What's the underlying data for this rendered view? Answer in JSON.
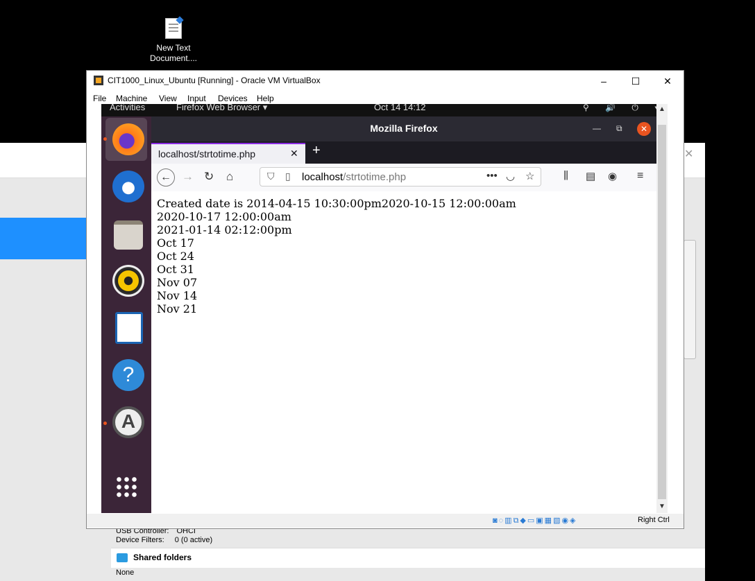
{
  "desktop": {
    "icon_label": "New Text Document...."
  },
  "vbox": {
    "title": "CIT1000_Linux_Ubuntu [Running] - Oracle VM VirtualBox",
    "minimize": "–",
    "maximize": "☐",
    "close": "✕",
    "menu": [
      "File",
      "Machine",
      "View",
      "Input",
      "Devices",
      "Help"
    ],
    "host_key": "Right Ctrl"
  },
  "gnome": {
    "activities": "Activities",
    "app_menu": "Firefox Web Browser ▾",
    "clock": "Oct 14  14:12",
    "tray": "⚲ 🔊 ⏻ ▾"
  },
  "firefox": {
    "window_title": "Mozilla Firefox",
    "tab_title": "localhost/strtotime.php",
    "new_tab": "+",
    "url_host": "localhost",
    "url_path": "/strtotime.php",
    "page_lines": [
      "Created date is 2014-04-15 10:30:00pm2020-10-15 12:00:00am",
      "2020-10-17 12:00:00am",
      "2021-01-14 02:12:00pm",
      "Oct 17",
      "Oct 24",
      "Oct 31",
      "Nov 07",
      "Nov 14",
      "Nov 21"
    ]
  },
  "manager": {
    "usb_label": "USB Controller:",
    "usb_value": "OHCI",
    "filters_label": "Device Filters:",
    "filters_value": "0 (0 active)",
    "shared_title": "Shared folders",
    "shared_value": "None"
  },
  "colors": {
    "ubuntu_orange": "#e95420",
    "dock": "#3b2538",
    "ff_dark": "#2b2a33"
  }
}
